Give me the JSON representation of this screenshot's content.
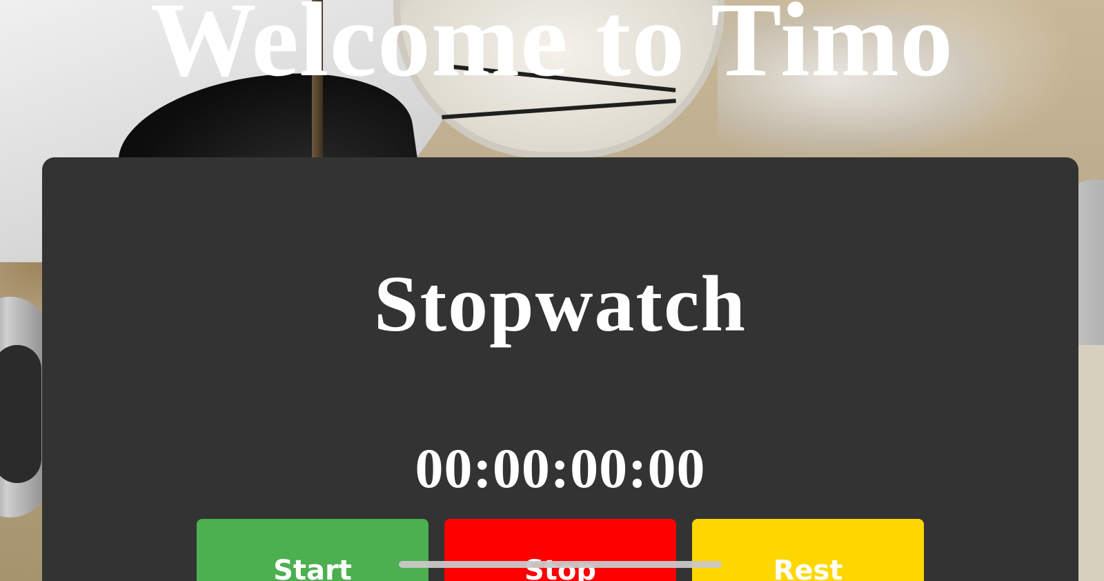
{
  "header": {
    "title": "Welcome to Timo"
  },
  "stopwatch": {
    "title": "Stopwatch",
    "time": "00:00:00:00",
    "buttons": {
      "start_label": "Start",
      "stop_label": "Stop",
      "reset_label": "Rest"
    }
  },
  "colors": {
    "panel_background": "#333333",
    "start_button": "#4caf50",
    "stop_button": "#ff0000",
    "reset_button": "#ffd700",
    "text": "#ffffff"
  }
}
